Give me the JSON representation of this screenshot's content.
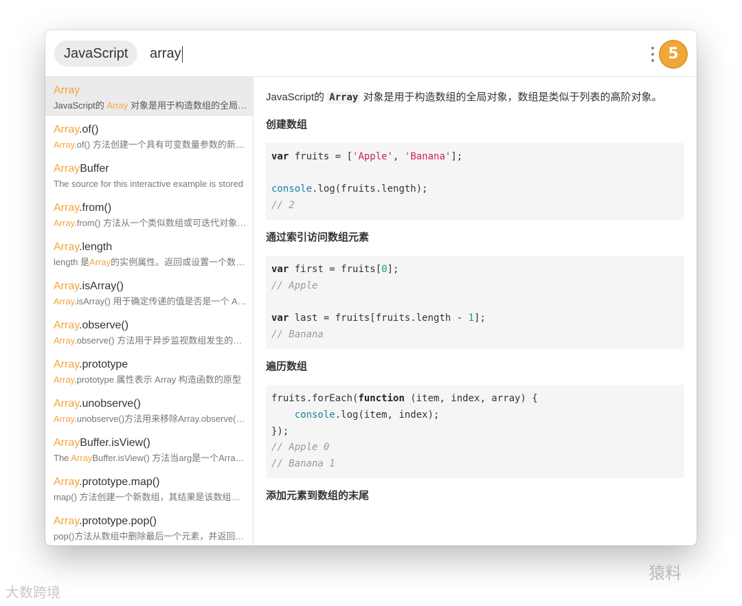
{
  "search": {
    "docset_tag": "JavaScript",
    "query": "array",
    "docset_icon_glyph": "5",
    "docset_icon": "html5-shield-icon",
    "accent": "#f5a43a"
  },
  "results": [
    {
      "hl": "Array",
      "title_rest": "",
      "desc_pre": "JavaScript的 ",
      "desc_hl": "Array",
      "desc_post": " 对象是用于构造数组的全局对象，数组是类似于列表的高阶对象。",
      "active": true
    },
    {
      "hl": "Array",
      "title_rest": ".of()",
      "desc_pre": "",
      "desc_hl": "Array",
      "desc_post": ".of() 方法创建一个具有可变数量参数的新数组实例",
      "active": false
    },
    {
      "hl": "Array",
      "title_rest": "Buffer",
      "desc_pre": "The source for this interactive example is stored",
      "desc_hl": "",
      "desc_post": "",
      "active": false
    },
    {
      "hl": "Array",
      "title_rest": ".from()",
      "desc_pre": "",
      "desc_hl": "Array",
      "desc_post": ".from() 方法从一个类似数组或可迭代对象中创建",
      "active": false
    },
    {
      "hl": "Array",
      "title_rest": ".length",
      "desc_pre": "length 是",
      "desc_hl": "Array",
      "desc_post": "的实例属性。返回或设置一个数组中的元素个数",
      "active": false
    },
    {
      "hl": "Array",
      "title_rest": ".isArray()",
      "desc_pre": "",
      "desc_hl": "Array",
      "desc_post": ".isArray() 用于确定传递的值是否是一个 Array",
      "active": false
    },
    {
      "hl": "Array",
      "title_rest": ".observe()",
      "desc_pre": "",
      "desc_hl": "Array",
      "desc_post": ".observe() 方法用于异步监视数组发生的变化",
      "active": false
    },
    {
      "hl": "Array",
      "title_rest": ".prototype",
      "desc_pre": "",
      "desc_hl": "Array",
      "desc_post": ".prototype 属性表示 Array 构造函数的原型",
      "active": false
    },
    {
      "hl": "Array",
      "title_rest": ".unobserve()",
      "desc_pre": "",
      "desc_hl": "Array",
      "desc_post": ".unobserve()方法用来移除Array.observe()设置的所有观察者",
      "active": false
    },
    {
      "hl": "Array",
      "title_rest": "Buffer.isView()",
      "desc_pre": "The ",
      "desc_hl": "Array",
      "desc_post": "Buffer.isView() 方法当arg是一个ArrayBuffer的视图时返回true",
      "active": false
    },
    {
      "hl": "Array",
      "title_rest": ".prototype.map()",
      "desc_pre": "map() 方法创建一个新数组，其结果是该数组中的每个元素调用",
      "desc_hl": "",
      "desc_post": "",
      "active": false
    },
    {
      "hl": "Array",
      "title_rest": ".prototype.pop()",
      "desc_pre": "pop()方法从数组中删除最后一个元素，并返回该元素的值",
      "desc_hl": "",
      "desc_post": "",
      "active": false
    }
  ],
  "detail": {
    "intro_pre": "JavaScript的 ",
    "intro_code": "Array",
    "intro_post": " 对象是用于构造数组的全局对象，数组是类似于列表的高阶对象。",
    "sections": [
      {
        "heading": "创建数组"
      },
      {
        "heading": "通过索引访问数组元素"
      },
      {
        "heading": "遍历数组"
      },
      {
        "heading": "添加元素到数组的末尾"
      }
    ],
    "code": {
      "c1_l1_kw": "var",
      "c1_l1_a": " fruits = [",
      "c1_l1_s1": "'Apple'",
      "c1_l1_b": ", ",
      "c1_l1_s2": "'Banana'",
      "c1_l1_c": "];",
      "c1_l2_obj": "console",
      "c1_l2_rest": ".log(fruits.length);",
      "c1_l3_cmt": "// 2",
      "c2_l1_kw": "var",
      "c2_l1_a": " first = fruits[",
      "c2_l1_n": "0",
      "c2_l1_b": "];",
      "c2_l2_cmt": "// Apple",
      "c2_l3_kw": "var",
      "c2_l3_a": " last = fruits[fruits.length - ",
      "c2_l3_n": "1",
      "c2_l3_b": "];",
      "c2_l4_cmt": "// Banana",
      "c3_l1_a": "fruits.forEach(",
      "c3_l1_kw": "function",
      "c3_l1_b": " (item, index, array) {",
      "c3_l2_obj": "console",
      "c3_l2_rest": ".log(item, index);",
      "c3_l3": "});",
      "c3_l4_cmt": "// Apple 0",
      "c3_l5_cmt": "// Banana 1"
    }
  },
  "watermarks": {
    "right": "猿料",
    "left": "大数跨境"
  }
}
